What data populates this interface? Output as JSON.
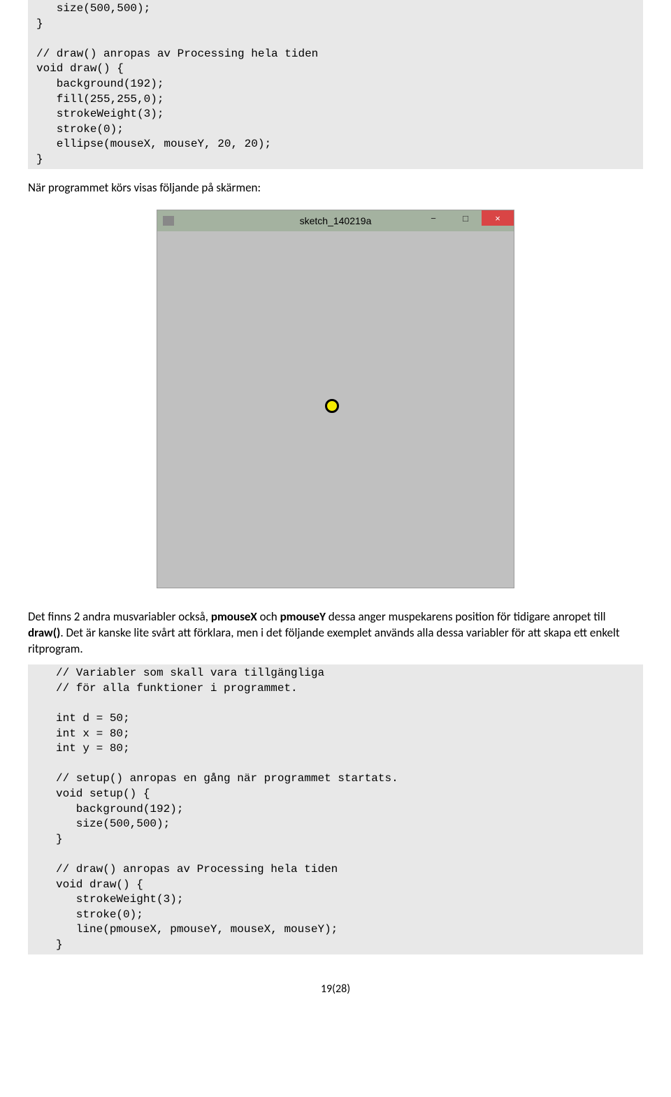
{
  "code1": "   size(500,500);\n}\n\n// draw() anropas av Processing hela tiden\nvoid draw() {\n   background(192);\n   fill(255,255,0);\n   strokeWeight(3);\n   stroke(0);\n   ellipse(mouseX, mouseY, 20, 20);\n}",
  "intro_text": "När programmet körs visas följande på skärmen:",
  "window": {
    "title": "sketch_140219a",
    "min": "−",
    "max": "□",
    "close": "×"
  },
  "para2_pre": "Det finns 2 andra musvariabler också, ",
  "b1": "pmouseX",
  "mid1": " och ",
  "b2": "pmouseY",
  "mid2": " dessa anger muspekarens position för tidigare anropet till ",
  "b3": "draw()",
  "para2_post": ". Det är kanske lite svårt att förklara, men i det följande exemplet används alla dessa variabler för att skapa ett enkelt ritprogram.",
  "code2": "// Variabler som skall vara tillgängliga\n// för alla funktioner i programmet.\n\nint d = 50;\nint x = 80;\nint y = 80;\n\n// setup() anropas en gång när programmet startats.\nvoid setup() {\n   background(192);\n   size(500,500);\n}\n\n// draw() anropas av Processing hela tiden\nvoid draw() {\n   strokeWeight(3);\n   stroke(0);\n   line(pmouseX, pmouseY, mouseX, mouseY);\n}",
  "page_num": "19(28)"
}
